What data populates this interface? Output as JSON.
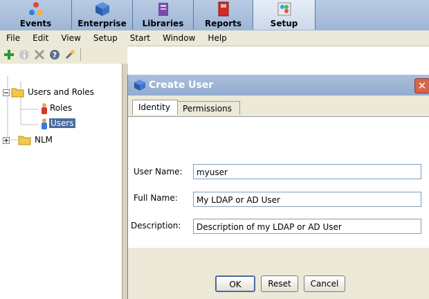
{
  "modules": [
    {
      "label": "Events",
      "icon": "events-icon"
    },
    {
      "label": "Enterprise",
      "icon": "enterprise-icon"
    },
    {
      "label": "Libraries",
      "icon": "libraries-icon"
    },
    {
      "label": "Reports",
      "icon": "reports-icon"
    },
    {
      "label": "Setup",
      "icon": "setup-icon",
      "active": true
    }
  ],
  "menu": [
    "File",
    "Edit",
    "View",
    "Setup",
    "Start",
    "Window",
    "Help"
  ],
  "toolbar": [
    "add-icon",
    "info-icon",
    "delete-icon",
    "help-icon",
    "tool-icon"
  ],
  "tree": {
    "root_label": "Users and Roles",
    "roles_label": "Roles",
    "users_label": "Users",
    "nlm_label": "NLM"
  },
  "dialog": {
    "title": "Create User",
    "tabs": [
      "Identity",
      "Permissions"
    ],
    "fields": {
      "user_name_label": "User Name:",
      "user_name_value": "myuser",
      "full_name_label": "Full Name:",
      "full_name_value": "My LDAP or AD  User",
      "description_label": "Description:",
      "description_value": "Description of my LDAP or AD User"
    },
    "buttons": {
      "ok": "OK",
      "reset": "Reset",
      "cancel": "Cancel"
    }
  },
  "colors": {
    "title_bar": "#9db6d6",
    "selection": "#4a6aa0",
    "panel": "#ece9d8"
  }
}
